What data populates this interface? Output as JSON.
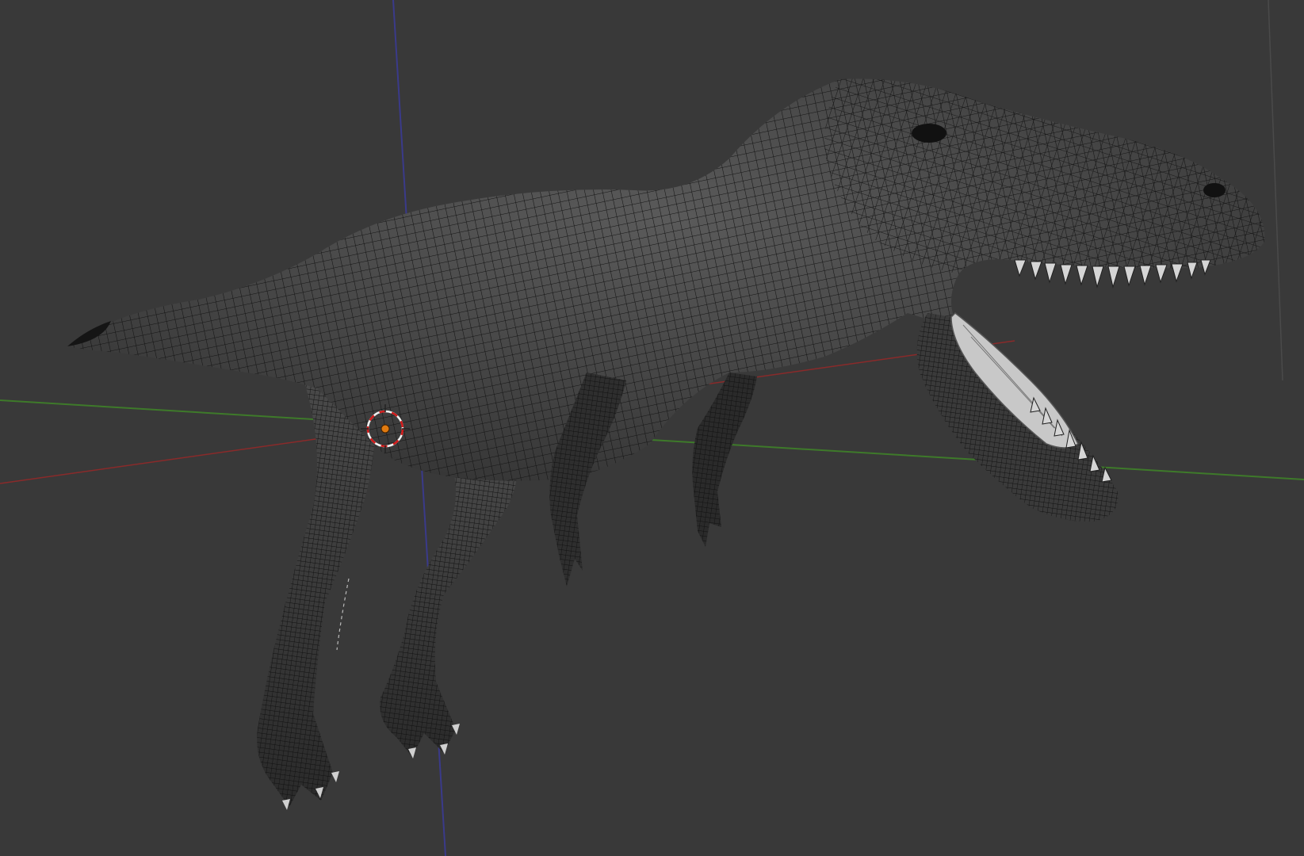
{
  "viewport": {
    "background": "#393939",
    "mode": "wireframe-over-solid",
    "axis_colors": {
      "x": "#8a2a2a",
      "y": "#3e7a2a",
      "z": "#3a3a8a"
    },
    "mesh": {
      "fill": "#4a4a4a",
      "wire": "#151515",
      "teeth": "#d8d8d8"
    },
    "cursor": {
      "ring_primary": "#d01818",
      "ring_secondary": "#f0f0f0",
      "origin": "#e07a10",
      "icon": "3d-cursor-icon"
    }
  }
}
